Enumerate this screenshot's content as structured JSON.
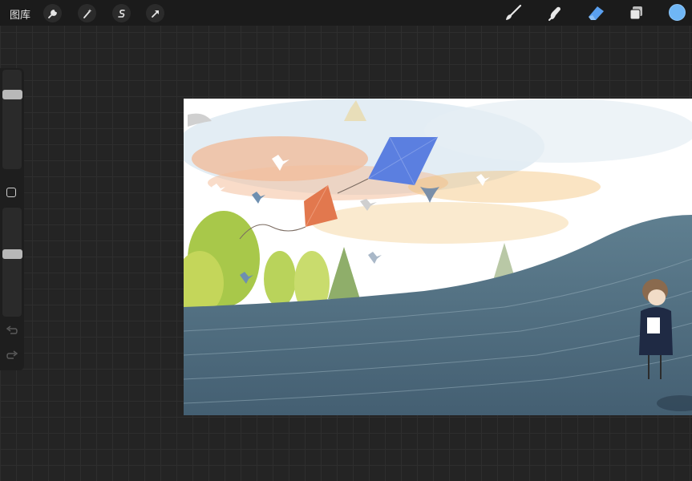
{
  "topbar": {
    "gallery_label": "图库",
    "left_tools": [
      "wrench-icon",
      "magic-wand-icon",
      "selection-icon",
      "transform-arrow-icon"
    ],
    "right_tools": [
      "brush-icon",
      "smudge-icon",
      "eraser-icon",
      "layers-icon"
    ],
    "active_tool": "eraser-icon",
    "current_color": "#6fb6f5"
  },
  "sidebar": {
    "brush_size": 0.78,
    "opacity": 0.58,
    "undo_icon": "undo-icon",
    "redo_icon": "redo-icon"
  },
  "canvas": {
    "artwork": "kites-birds-sea-girl-illustration",
    "colors": {
      "sky": "#ffffff",
      "sea": "#4f6d80",
      "kite_blue": "#5b7fe0",
      "kite_orange": "#e2784e"
    }
  }
}
